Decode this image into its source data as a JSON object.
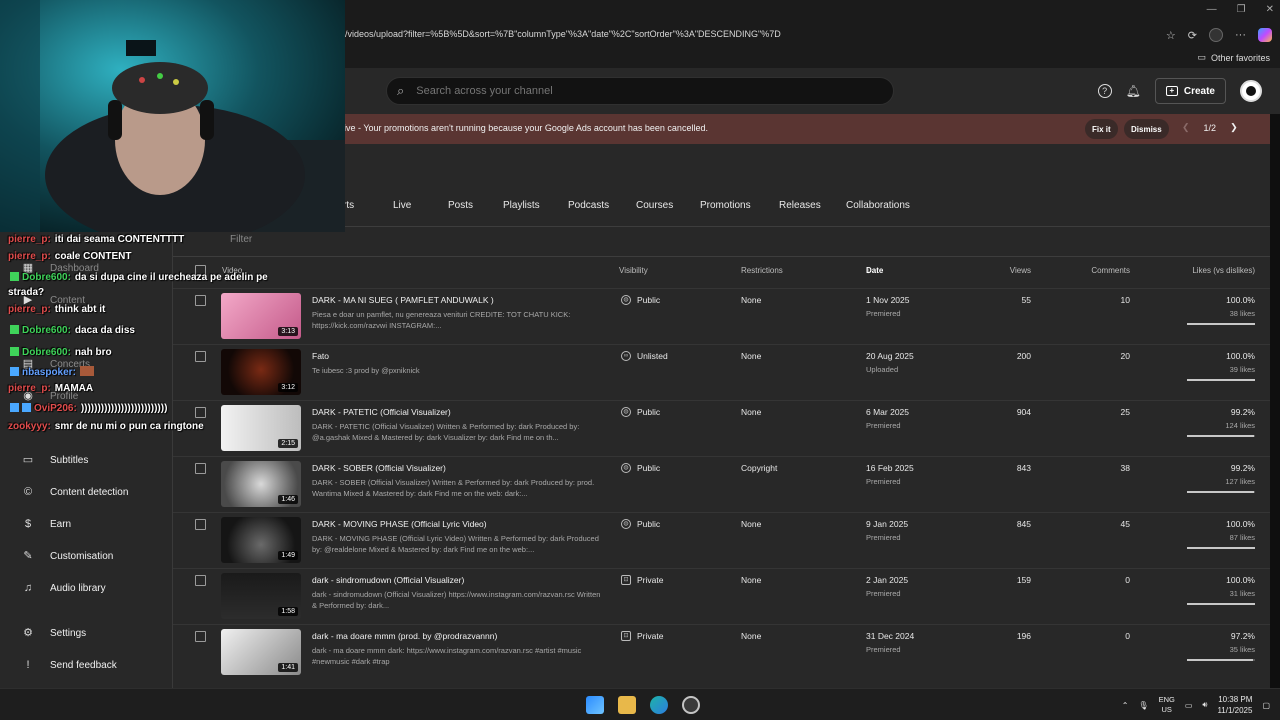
{
  "browser": {
    "address": "/videos/upload?filter=%5B%5D&sort=%7B\"columnType\"%3A\"date\"%2C\"sortOrder\"%3A\"DESCENDING\"%7D",
    "other_favorites": "Other favorites"
  },
  "header": {
    "search_placeholder": "Search across your channel",
    "create_label": "Create"
  },
  "banner": {
    "text": "ive - Your promotions aren't running because your Google Ads account has been cancelled.",
    "fix_label": "Fix it",
    "dismiss_label": "Dismiss",
    "page": "1/2"
  },
  "tabs": [
    "rts",
    "Live",
    "Posts",
    "Playlists",
    "Podcasts",
    "Courses",
    "Promotions",
    "Releases",
    "Collaborations"
  ],
  "filter_placeholder": "Filter",
  "columns": {
    "video": "Video",
    "visibility": "Visibility",
    "restrictions": "Restrictions",
    "date": "Date",
    "views": "Views",
    "comments": "Comments",
    "likes": "Likes (vs dislikes)"
  },
  "videos": [
    {
      "title": "DARK - MA NI SUEG ( PAMFLET ANDUWALK )",
      "desc": "Piesa e doar un pamflet, nu genereaza venituri CREDITE: TOT CHATU KICK: https://kick.com/razvwi INSTAGRAM:...",
      "duration": "3:13",
      "visibility": "Public",
      "restrictions": "None",
      "date": "1 Nov 2025",
      "status": "Premiered",
      "views": "55",
      "comments": "10",
      "likes": "100.0%",
      "likes_count": "38 likes",
      "like_ratio": 1.0
    },
    {
      "title": "Fato",
      "desc": "Te iubesc :3 prod by @pxniknick",
      "duration": "3:12",
      "visibility": "Unlisted",
      "restrictions": "None",
      "date": "20 Aug 2025",
      "status": "Uploaded",
      "views": "200",
      "comments": "20",
      "likes": "100.0%",
      "likes_count": "39 likes",
      "like_ratio": 1.0
    },
    {
      "title": "DARK - PATETIC (Official Visualizer)",
      "desc": "DARK - PATETIC (Official Visualizer) Written & Performed by: dark Produced by: @a.gashak Mixed & Mastered by: dark Visualizer by: dark Find me on th...",
      "duration": "2:15",
      "visibility": "Public",
      "restrictions": "None",
      "date": "6 Mar 2025",
      "status": "Premiered",
      "views": "904",
      "comments": "25",
      "likes": "99.2%",
      "likes_count": "124 likes",
      "like_ratio": 0.992
    },
    {
      "title": "DARK - SOBER (Official Visualizer)",
      "desc": "DARK - SOBER (Official Visualizer) Written & Performed by: dark Produced by: prod. Wantima Mixed & Mastered by: dark Find me on the web: dark:...",
      "duration": "1:46",
      "visibility": "Public",
      "restrictions": "Copyright",
      "date": "16 Feb 2025",
      "status": "Premiered",
      "views": "843",
      "comments": "38",
      "likes": "99.2%",
      "likes_count": "127 likes",
      "like_ratio": 0.992
    },
    {
      "title": "DARK - MOVING PHASE (Official Lyric Video)",
      "desc": "DARK - MOVING PHASE (Official Lyric Video) Written & Performed by: dark Produced by: @realdelone Mixed & Mastered by: dark Find me on the web:...",
      "duration": "1:49",
      "visibility": "Public",
      "restrictions": "None",
      "date": "9 Jan 2025",
      "status": "Premiered",
      "views": "845",
      "comments": "45",
      "likes": "100.0%",
      "likes_count": "87 likes",
      "like_ratio": 1.0
    },
    {
      "title": "dark - sindromudown (Official Visualizer)",
      "desc": "dark - sindromudown (Official Visualizer) https://www.instagram.com/razvan.rsc Written & Performed by: dark...",
      "duration": "1:58",
      "visibility": "Private",
      "restrictions": "None",
      "date": "2 Jan 2025",
      "status": "Premiered",
      "views": "159",
      "comments": "0",
      "likes": "100.0%",
      "likes_count": "31 likes",
      "like_ratio": 1.0
    },
    {
      "title": "dark - ma doare mmm (prod. by @prodrazvannn)",
      "desc": "dark - ma doare mmm dark: https://www.instagram.com/razvan.rsc #artist #music #newmusic #dark #trap",
      "duration": "1:41",
      "visibility": "Private",
      "restrictions": "None",
      "date": "31 Dec 2024",
      "status": "Premiered",
      "views": "196",
      "comments": "0",
      "likes": "97.2%",
      "likes_count": "35 likes",
      "like_ratio": 0.972
    }
  ],
  "sidebar": {
    "dashboard": "Dashboard",
    "content": "Content",
    "concerts": "Concerts",
    "profile": "Profile",
    "subtitles": "Subtitles",
    "content_detection": "Content detection",
    "earn": "Earn",
    "customisation": "Customisation",
    "audio_library": "Audio library",
    "settings": "Settings",
    "send_feedback": "Send feedback"
  },
  "chat": [
    {
      "user": "pierre_p:",
      "msg": "iti dai seama CONTENTTTT"
    },
    {
      "user": "pierre_p:",
      "msg": "coale CONTENT"
    },
    {
      "user": "Dobre600:",
      "msg": "da si dupa cine il urecheaza pe adelin pe"
    },
    {
      "user": "",
      "msg": "strada?"
    },
    {
      "user": "pierre_p:",
      "msg": "think abt it"
    },
    {
      "user": "Dobre600:",
      "msg": "daca da diss"
    },
    {
      "user": "Dobre600:",
      "msg": "nah bro"
    },
    {
      "user": "nbaspoker:",
      "msg": ""
    },
    {
      "user": "pierre_p:",
      "msg": "MAMAA"
    },
    {
      "user": "OviP206:",
      "msg": "))))))))))))))))))))))))))"
    },
    {
      "user": "zookyyy:",
      "msg": "smr de nu mi o pun ca ringtone"
    }
  ],
  "taskbar": {
    "lang1": "ENG",
    "lang2": "US",
    "time": "10:38 PM",
    "date": "11/1/2025"
  }
}
